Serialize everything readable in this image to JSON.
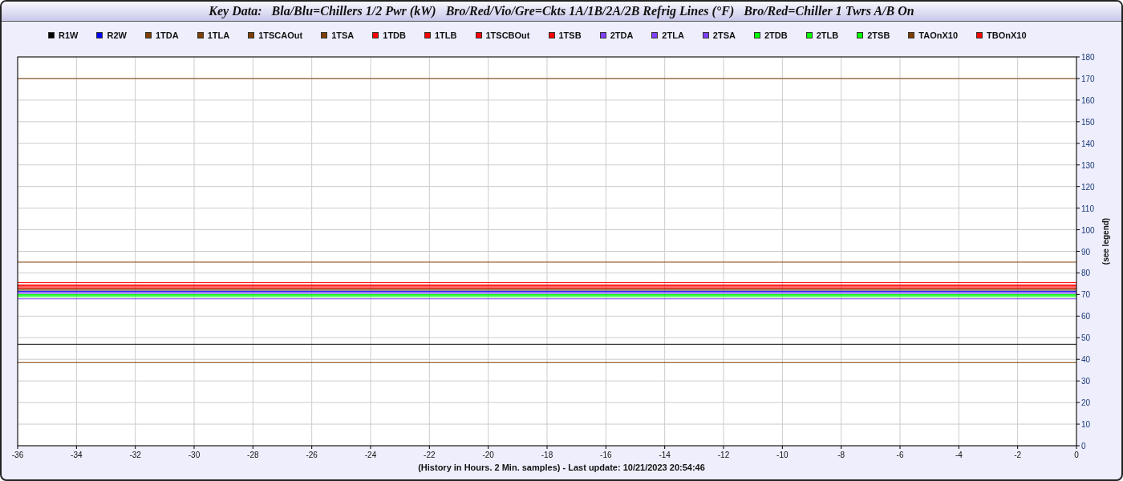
{
  "title": "Key Data:   Bla/Blu=Chillers 1/2 Pwr (kW)   Bro/Red/Vio/Gre=Ckts 1A/1B/2A/2B Refrig Lines (°F)   Bro/Red=Chiller 1 Twrs A/B On",
  "chart_data": {
    "type": "line",
    "grid": true,
    "xlabel": "(History in Hours. 2 Min. samples) - Last update: 10/21/2023 20:54:46",
    "ylabel": "(see legend)",
    "x": [
      -36,
      0
    ],
    "xlim": [
      -36,
      0
    ],
    "ylim": [
      0,
      180
    ],
    "xticks": [
      -36,
      -34,
      -32,
      -30,
      -28,
      -26,
      -24,
      -22,
      -20,
      -18,
      -16,
      -14,
      -12,
      -10,
      -8,
      -6,
      -4,
      -2,
      0
    ],
    "yticks": [
      0,
      10,
      20,
      30,
      40,
      50,
      60,
      70,
      80,
      90,
      100,
      110,
      120,
      130,
      140,
      150,
      160,
      170,
      180
    ],
    "series": [
      {
        "name": "R1W",
        "color": "#000000",
        "values": [
          47,
          47
        ]
      },
      {
        "name": "R2W",
        "color": "#0000ff",
        "values": [
          71.5,
          71.5
        ]
      },
      {
        "name": "1TDA",
        "color": "#7f3f00",
        "values": [
          170,
          170
        ]
      },
      {
        "name": "1TLA",
        "color": "#7f3f00",
        "values": [
          85,
          85
        ]
      },
      {
        "name": "1TSCAOut",
        "color": "#7f3f00",
        "values": [
          72.5,
          72.5
        ]
      },
      {
        "name": "1TSA",
        "color": "#7f3f00",
        "values": [
          72,
          72
        ]
      },
      {
        "name": "1TDB",
        "color": "#ff0000",
        "values": [
          75.5,
          75.5
        ]
      },
      {
        "name": "1TLB",
        "color": "#ff0000",
        "values": [
          73.5,
          73.5
        ]
      },
      {
        "name": "1TSCBOut",
        "color": "#ff0000",
        "values": [
          74,
          74
        ]
      },
      {
        "name": "1TSB",
        "color": "#ff0000",
        "values": [
          74.5,
          74.5
        ]
      },
      {
        "name": "2TDA",
        "color": "#7f3fff",
        "values": [
          68,
          68
        ]
      },
      {
        "name": "2TLA",
        "color": "#7f3fff",
        "values": [
          71,
          71
        ]
      },
      {
        "name": "2TSA",
        "color": "#7f3fff",
        "values": [
          70.5,
          70.5
        ]
      },
      {
        "name": "2TDB",
        "color": "#00ff00",
        "values": [
          69.5,
          69.5
        ]
      },
      {
        "name": "2TLB",
        "color": "#00ff00",
        "values": [
          69,
          69
        ]
      },
      {
        "name": "2TSB",
        "color": "#00ff00",
        "values": [
          70,
          70
        ]
      },
      {
        "name": "TAOnX10",
        "color": "#7f3f00",
        "values": [
          38.5,
          38.5
        ]
      },
      {
        "name": "TBOnX10",
        "color": "#ff0000",
        "values": [
          73,
          73
        ]
      }
    ]
  }
}
